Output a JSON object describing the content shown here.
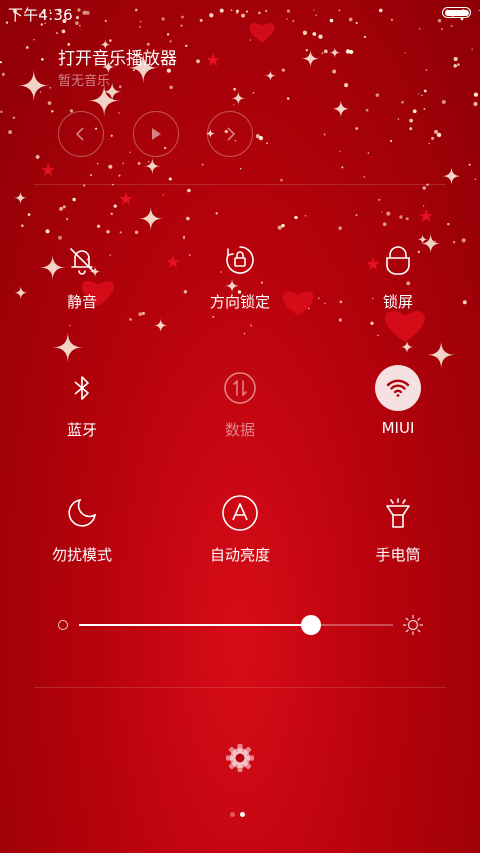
{
  "status_bar": {
    "time": "下午4:36"
  },
  "music": {
    "title": "打开音乐播放器",
    "subtitle": "暂无音乐",
    "controls": [
      "previous-icon",
      "play-icon",
      "next-icon"
    ]
  },
  "toggles": [
    {
      "id": "mute",
      "label": "静音",
      "icon": "bell-muted-icon",
      "state": "off"
    },
    {
      "id": "rotation-lock",
      "label": "方向锁定",
      "icon": "rotation-lock-icon",
      "state": "off"
    },
    {
      "id": "lock-screen",
      "label": "锁屏",
      "icon": "lock-icon",
      "state": "off"
    },
    {
      "id": "bluetooth",
      "label": "蓝牙",
      "icon": "bluetooth-icon",
      "state": "off"
    },
    {
      "id": "data",
      "label": "数据",
      "icon": "data-arrows-icon",
      "state": "disabled"
    },
    {
      "id": "wifi",
      "label": "MIUI",
      "icon": "wifi-icon",
      "state": "on"
    },
    {
      "id": "dnd",
      "label": "勿扰模式",
      "icon": "moon-icon",
      "state": "off"
    },
    {
      "id": "auto-brightness",
      "label": "自动亮度",
      "icon": "auto-brightness-icon",
      "state": "off"
    },
    {
      "id": "flashlight",
      "label": "手电筒",
      "icon": "flashlight-icon",
      "state": "off"
    }
  ],
  "brightness": {
    "level": 0.74
  },
  "pager": {
    "pages": 2,
    "current": 1
  },
  "colors": {
    "background": "#b5020c",
    "foreground": "#ffffff",
    "active_icon": "#b0040c"
  }
}
